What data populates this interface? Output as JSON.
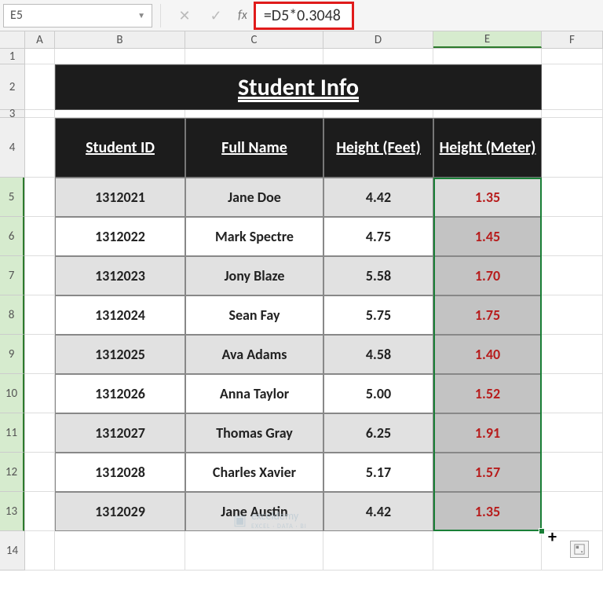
{
  "nameBox": "E5",
  "formula": "=D5*0.3048",
  "columns": [
    "A",
    "B",
    "C",
    "D",
    "E",
    "F"
  ],
  "rowNumbers": [
    "1",
    "2",
    "3",
    "4",
    "5",
    "6",
    "7",
    "8",
    "9",
    "10",
    "11",
    "12",
    "13",
    "14"
  ],
  "title": "Student Info",
  "headers": {
    "id": "Student ID",
    "name": "Full Name",
    "hfeet": "Height (Feet)",
    "hmeter": "Height (Meter)"
  },
  "rows": [
    {
      "id": "1312021",
      "name": "Jane Doe",
      "feet": "4.42",
      "meter": "1.35"
    },
    {
      "id": "1312022",
      "name": "Mark Spectre",
      "feet": "4.75",
      "meter": "1.45"
    },
    {
      "id": "1312023",
      "name": "Jony Blaze",
      "feet": "5.58",
      "meter": "1.70"
    },
    {
      "id": "1312024",
      "name": "Sean Fay",
      "feet": "5.75",
      "meter": "1.75"
    },
    {
      "id": "1312025",
      "name": "Ava Adams",
      "feet": "4.58",
      "meter": "1.40"
    },
    {
      "id": "1312026",
      "name": "Anna Taylor",
      "feet": "5.00",
      "meter": "1.52"
    },
    {
      "id": "1312027",
      "name": "Thomas Gray",
      "feet": "6.25",
      "meter": "1.91"
    },
    {
      "id": "1312028",
      "name": "Charles Xavier",
      "feet": "5.17",
      "meter": "1.57"
    },
    {
      "id": "1312029",
      "name": "Jane Austin",
      "feet": "4.42",
      "meter": "1.35"
    }
  ],
  "watermark": {
    "brand": "exceldemy",
    "tagline": "EXCEL · DATA · BI"
  }
}
